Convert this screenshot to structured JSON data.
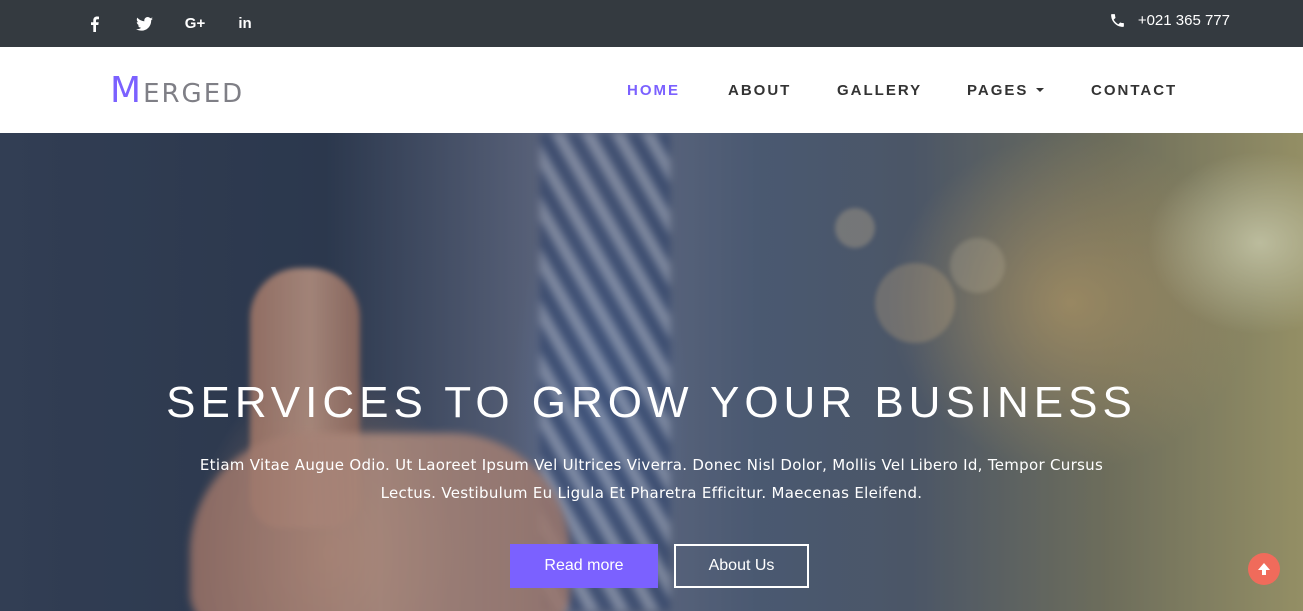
{
  "topbar": {
    "social": [
      {
        "icon": "facebook-icon",
        "glyph": "f"
      },
      {
        "icon": "twitter-icon",
        "glyph": "t"
      },
      {
        "icon": "google-plus-icon",
        "glyph": "G+"
      },
      {
        "icon": "linkedin-icon",
        "glyph": "in"
      }
    ],
    "phone": "+021 365 777"
  },
  "navbar": {
    "logo_first": "M",
    "logo_rest": "ERGED",
    "items": [
      {
        "label": "HOME",
        "active": true
      },
      {
        "label": "ABOUT",
        "active": false
      },
      {
        "label": "GALLERY",
        "active": false
      },
      {
        "label": "PAGES",
        "active": false,
        "dropdown": true
      },
      {
        "label": "CONTACT",
        "active": false
      }
    ]
  },
  "hero": {
    "title": "SERVICES TO GROW YOUR BUSINESS",
    "text": "Etiam Vitae Augue Odio. Ut Laoreet Ipsum Vel Ultrices Viverra. Donec Nisl Dolor, Mollis Vel Libero Id, Tempor Cursus Lectus. Vestibulum Eu Ligula Et Pharetra Efficitur. Maecenas Eleifend.",
    "primary_button": "Read more",
    "secondary_button": "About Us"
  },
  "colors": {
    "accent": "#7b61ff",
    "topbar": "#343a40",
    "scroll_top": "#f06b5b"
  }
}
